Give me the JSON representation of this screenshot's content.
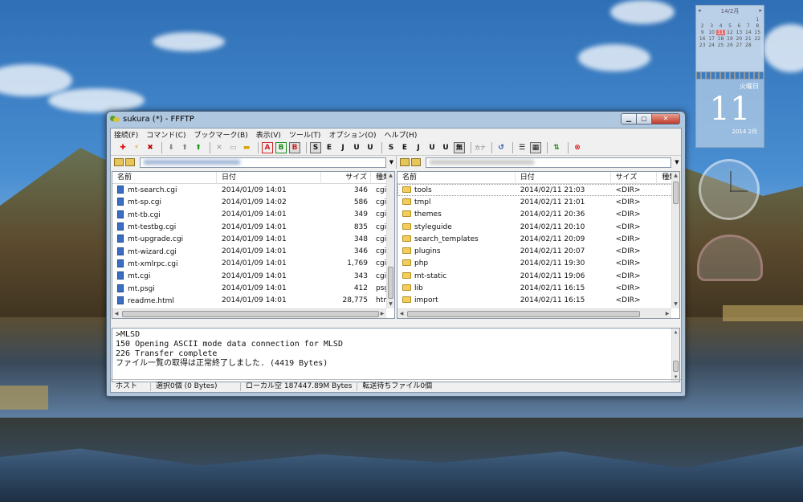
{
  "window": {
    "title": "sukura (*) - FFFTP",
    "buttons": {
      "minimize": "▁",
      "maximize": "▢",
      "close": "✕"
    }
  },
  "menu": [
    "接続(F)",
    "コマンド(C)",
    "ブックマーク(B)",
    "表示(V)",
    "ツール(T)",
    "オプション(O)",
    "ヘルプ(H)"
  ],
  "toolbar": {
    "labels": {
      "asc": "A",
      "bin": "B",
      "auto": "B",
      "sjis": "S",
      "euc": "E",
      "jis": "J",
      "utf8": "U",
      "utf8bom": "U",
      "kana": "カナ",
      "none": "無"
    }
  },
  "local_pane": {
    "headers": {
      "name": "名前",
      "date": "日付",
      "size": "サイズ",
      "type": "種類"
    },
    "rows": [
      {
        "name": "mt-search.cgi",
        "date": "2014/01/09 14:01",
        "size": "346",
        "type": "cgi"
      },
      {
        "name": "mt-sp.cgi",
        "date": "2014/01/09 14:02",
        "size": "586",
        "type": "cgi"
      },
      {
        "name": "mt-tb.cgi",
        "date": "2014/01/09 14:01",
        "size": "349",
        "type": "cgi"
      },
      {
        "name": "mt-testbg.cgi",
        "date": "2014/01/09 14:01",
        "size": "835",
        "type": "cgi"
      },
      {
        "name": "mt-upgrade.cgi",
        "date": "2014/01/09 14:01",
        "size": "348",
        "type": "cgi"
      },
      {
        "name": "mt-wizard.cgi",
        "date": "2014/01/09 14:01",
        "size": "346",
        "type": "cgi"
      },
      {
        "name": "mt-xmlrpc.cgi",
        "date": "2014/01/09 14:01",
        "size": "1,769",
        "type": "cgi"
      },
      {
        "name": "mt.cgi",
        "date": "2014/01/09 14:01",
        "size": "343",
        "type": "cgi"
      },
      {
        "name": "mt.psgi",
        "date": "2014/01/09 14:01",
        "size": "412",
        "type": "psgi"
      },
      {
        "name": "readme.html",
        "date": "2014/01/09 14:01",
        "size": "28,775",
        "type": "html"
      }
    ]
  },
  "remote_pane": {
    "headers": {
      "name": "名前",
      "date": "日付",
      "size": "サイズ",
      "type": "種類"
    },
    "rows": [
      {
        "name": "tools",
        "date": "2014/02/11 21:03",
        "size": "<DIR>",
        "type": ""
      },
      {
        "name": "tmpl",
        "date": "2014/02/11 21:01",
        "size": "<DIR>",
        "type": ""
      },
      {
        "name": "themes",
        "date": "2014/02/11 20:36",
        "size": "<DIR>",
        "type": ""
      },
      {
        "name": "styleguide",
        "date": "2014/02/11 20:10",
        "size": "<DIR>",
        "type": ""
      },
      {
        "name": "search_templates",
        "date": "2014/02/11 20:09",
        "size": "<DIR>",
        "type": ""
      },
      {
        "name": "plugins",
        "date": "2014/02/11 20:07",
        "size": "<DIR>",
        "type": ""
      },
      {
        "name": "php",
        "date": "2014/02/11 19:30",
        "size": "<DIR>",
        "type": ""
      },
      {
        "name": "mt-static",
        "date": "2014/02/11 19:06",
        "size": "<DIR>",
        "type": ""
      },
      {
        "name": "lib",
        "date": "2014/02/11 16:15",
        "size": "<DIR>",
        "type": ""
      },
      {
        "name": "import",
        "date": "2014/02/11 16:15",
        "size": "<DIR>",
        "type": ""
      }
    ]
  },
  "log": [
    ">MLSD",
    "150 Opening ASCII mode data connection for MLSD",
    "226 Transfer complete",
    "ファイル一覧の取得は正常終了しました. (4419 Bytes)"
  ],
  "status": {
    "host": "ホスト",
    "selection": "選択0個 (0 Bytes)",
    "local_free": "ローカル空 187447.89M Bytes",
    "queue": "転送待ちファイル0個"
  },
  "gadget_calendar": {
    "month": "14/2月",
    "weekday": "火曜日",
    "day": "11",
    "year_month": "2014 2月",
    "days": [
      "",
      "",
      "",
      "",
      "",
      "",
      "1",
      "2",
      "3",
      "4",
      "5",
      "6",
      "7",
      "8",
      "9",
      "10",
      "11",
      "12",
      "13",
      "14",
      "15",
      "16",
      "17",
      "18",
      "19",
      "20",
      "21",
      "22",
      "23",
      "24",
      "25",
      "26",
      "27",
      "28",
      ""
    ]
  },
  "colors": {
    "accent": "#3c6fc4",
    "folder": "#f2cd5c",
    "close_button": "#c0392b"
  }
}
